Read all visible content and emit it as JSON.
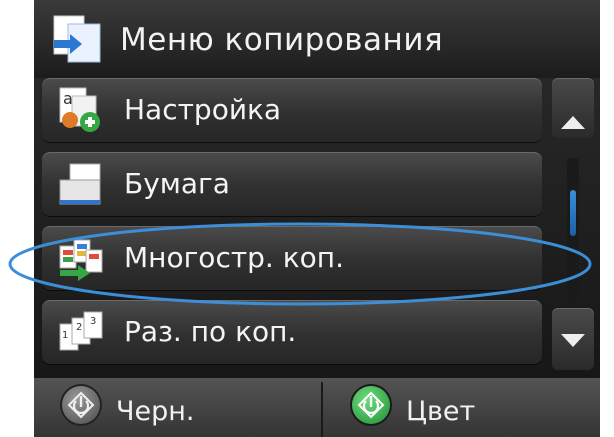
{
  "header": {
    "title": "Меню копирования",
    "icon": "copy-menu-icon"
  },
  "menu": {
    "items": [
      {
        "label": "Настройка",
        "icon": "settings-doc-icon"
      },
      {
        "label": "Бумага",
        "icon": "paper-icon"
      },
      {
        "label": "Многостр. коп.",
        "icon": "multipage-copy-icon",
        "highlighted": true
      },
      {
        "label": "Раз. по коп.",
        "icon": "collate-icon"
      }
    ]
  },
  "scroll": {
    "up": "scroll-up-icon",
    "down": "scroll-down-icon"
  },
  "bottom": {
    "black": {
      "label": "Черн.",
      "icon": "start-black-icon"
    },
    "color": {
      "label": "Цвет",
      "icon": "start-color-icon"
    }
  },
  "colors": {
    "highlight_outline": "#3c8fd6",
    "start_green": "#2db34a"
  }
}
